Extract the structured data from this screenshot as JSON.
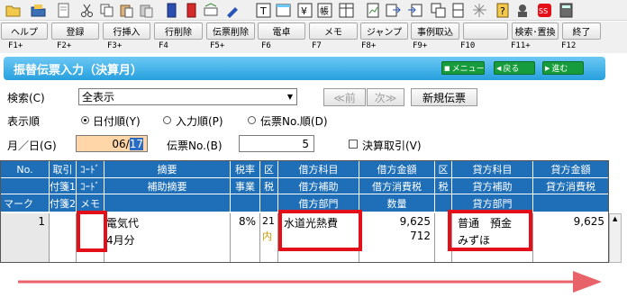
{
  "fkeys": [
    {
      "label": "ヘルプ",
      "key": "F1+"
    },
    {
      "label": "登録",
      "key": "F2+"
    },
    {
      "label": "行挿入",
      "key": "F3+"
    },
    {
      "label": "行削除",
      "key": "F4"
    },
    {
      "label": "伝票削除",
      "key": "F5+"
    },
    {
      "label": "電卓",
      "key": "F6"
    },
    {
      "label": "メモ",
      "key": "F7"
    },
    {
      "label": "ジャンプ",
      "key": "F8+"
    },
    {
      "label": "事例取込",
      "key": "F9+"
    },
    {
      "label": "",
      "key": "F10"
    },
    {
      "label": "検索･置換",
      "key": "F11+"
    },
    {
      "label": "終了",
      "key": "F12"
    }
  ],
  "title": {
    "text": "振替伝票入力（決算月）",
    "menu_btn": "メニュー",
    "back_btn": "戻る",
    "next_btn": "進む"
  },
  "search": {
    "label": "検索(C)",
    "value": "全表示",
    "prev_btn": "≪前",
    "next_btn": "次≫",
    "new_btn": "新規伝票"
  },
  "order": {
    "label": "表示順",
    "options": [
      "日付順(Y)",
      "入力順(P)",
      "伝票No.順(D)"
    ]
  },
  "date_row": {
    "date_label": "月／日(G)",
    "date_month": "06/",
    "date_day": "17",
    "slip_label": "伝票No.(B)",
    "slip_value": "5",
    "closing_label": "決算取引(V)"
  },
  "grid_headers": {
    "row1": [
      "No.",
      "取引",
      "ｺｰﾄﾞ",
      "摘要",
      "税率",
      "区",
      "借方科目",
      "借方金額",
      "区",
      "貸方科目",
      "貸方金額"
    ],
    "row2": [
      "",
      "付箋1",
      "ｺｰﾄﾞ",
      "補助摘要",
      "事業",
      "税",
      "借方補助",
      "借方消費税",
      "税",
      "貸方補助",
      "貸方消費税"
    ],
    "row3": [
      "マーク",
      "付箋2",
      "メモ",
      "",
      "",
      "",
      "借方部門",
      "数量",
      "",
      "貸方部門",
      ""
    ]
  },
  "entry": {
    "no": "1",
    "memo1": "電気代",
    "memo2": "4月分",
    "tax_rate": "8%",
    "kbn_code": "21",
    "kbn_sub": "内",
    "debit_account": "水道光熱費",
    "debit_amount": "9,625",
    "debit_tax": "712",
    "credit_account": "普通　預金",
    "credit_sub": "みずほ",
    "credit_amount": "9,625"
  },
  "colors": {
    "header_blue": "#1e6fb8",
    "title_blue": "#26a0de",
    "highlight_red": "#e3101a",
    "arrow_red": "#e8626a",
    "date_fill": "#ffd6a8"
  }
}
